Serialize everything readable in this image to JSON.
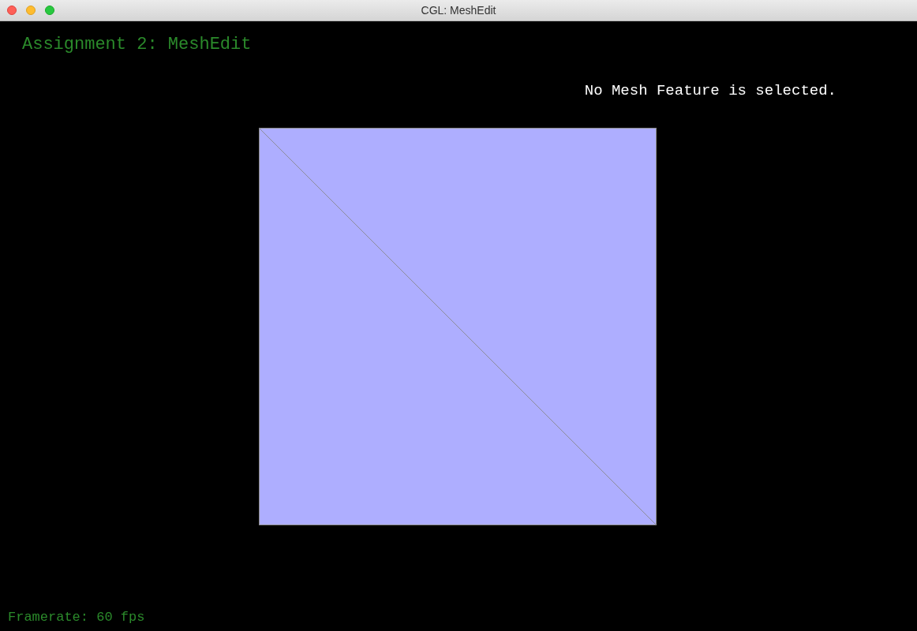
{
  "window": {
    "title": "CGL: MeshEdit"
  },
  "viewport": {
    "heading": "Assignment 2: MeshEdit",
    "selection_info": "No Mesh Feature is selected.",
    "framerate": "Framerate: 60 fps"
  }
}
